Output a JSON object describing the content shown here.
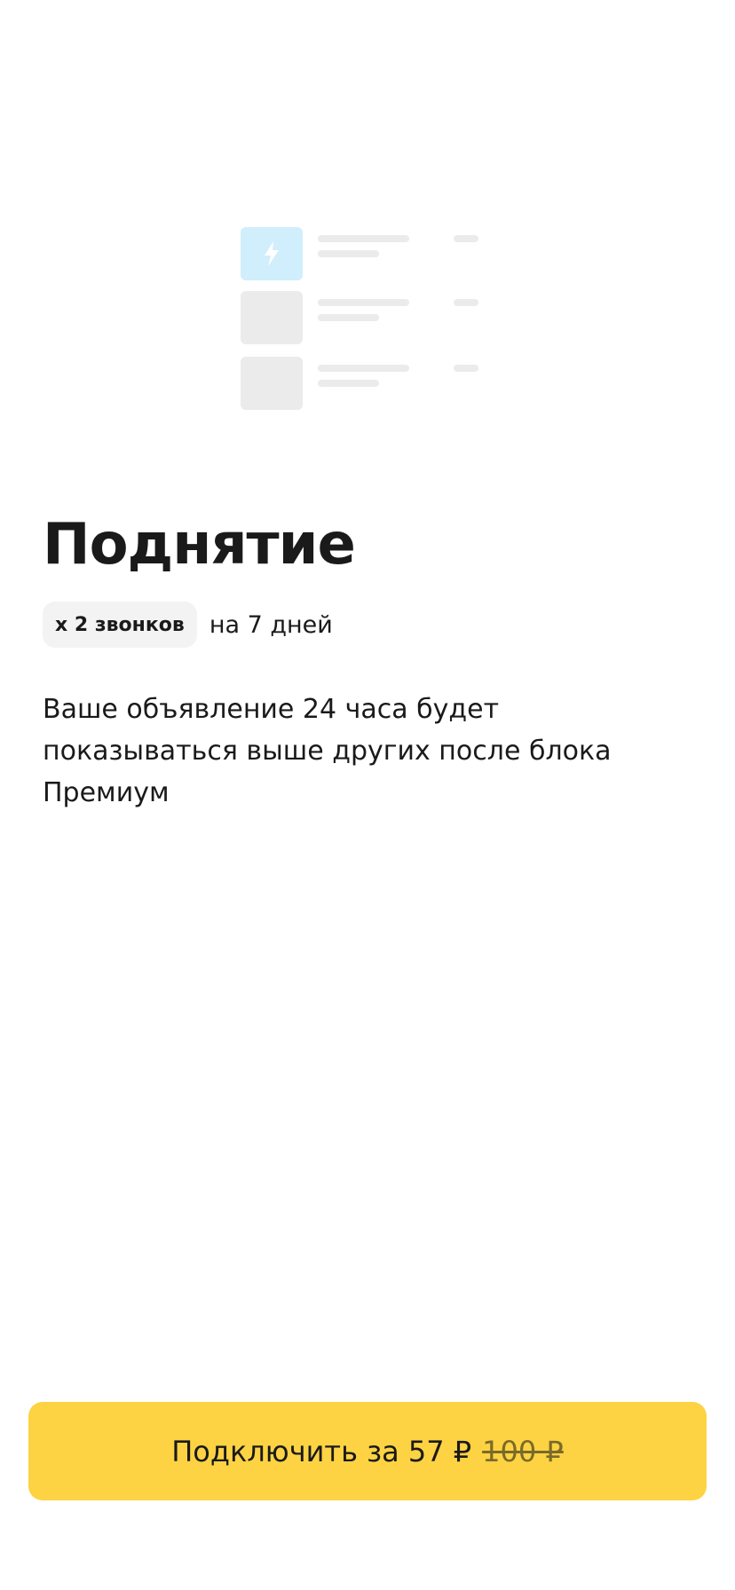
{
  "colors": {
    "accent": "#fdd343",
    "highlight_thumb": "#d1eefc",
    "lightning": "#ffffff",
    "skeleton": "#ebebeb",
    "badge_bg": "#f3f3f3",
    "text": "#1a1a1a"
  },
  "illustration": {
    "icon": "lightning-icon",
    "rows": 3
  },
  "title": "Поднятие",
  "badge": "x 2 звонков",
  "duration": "на 7 дней",
  "description": "Ваше объявление 24 часа будет показываться выше других после блока Премиум",
  "cta": {
    "label": "Подключить за 57 ₽",
    "old_price": "100 ₽"
  }
}
